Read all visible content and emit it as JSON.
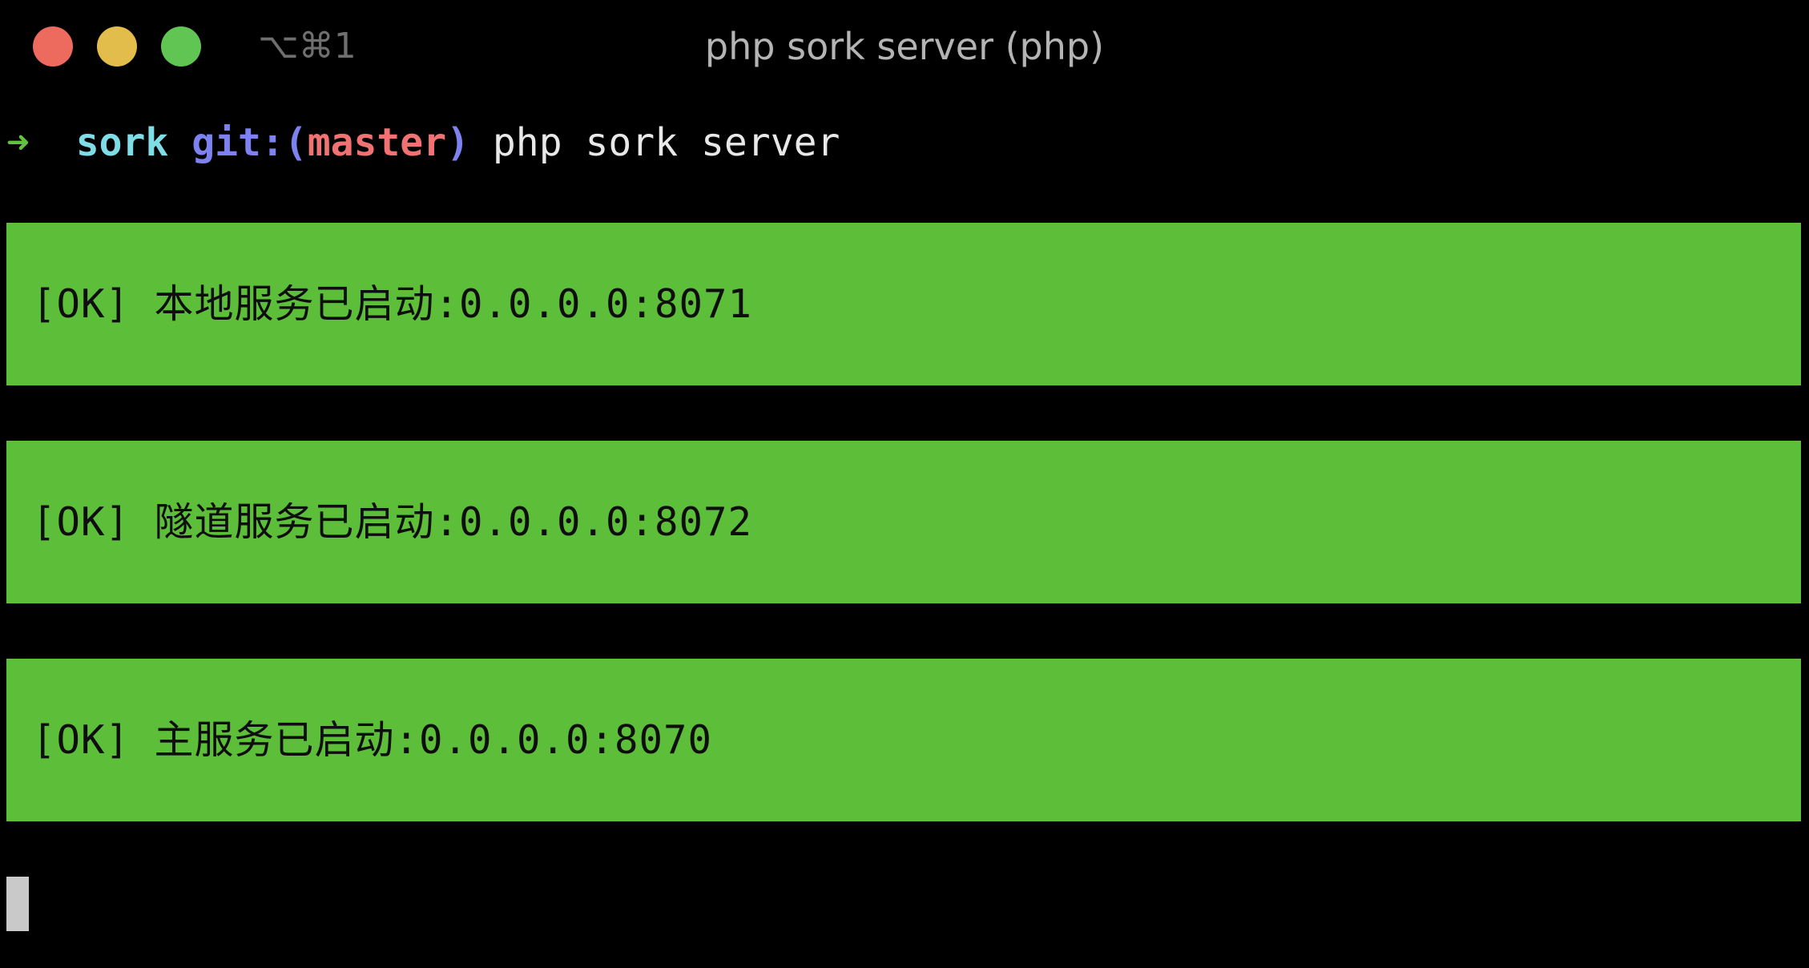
{
  "window": {
    "shortcut": "⌥⌘1",
    "title": "php sork server (php)"
  },
  "prompt": {
    "arrow": "➜",
    "directory": "sork",
    "git_prefix": "git:(",
    "branch": "master",
    "git_suffix": ")",
    "command": "php sork server"
  },
  "output": [
    {
      "text": "[OK] 本地服务已启动:0.0.0.0:8071"
    },
    {
      "text": "[OK] 隧道服务已启动:0.0.0.0:8072"
    },
    {
      "text": "[OK] 主服务已启动:0.0.0.0:8070"
    }
  ],
  "colors": {
    "background": "#000000",
    "ok_block": "#5dbe3a",
    "arrow": "#5fc33f",
    "directory": "#7fdde8",
    "git": "#7d82f0",
    "branch": "#f07272"
  }
}
